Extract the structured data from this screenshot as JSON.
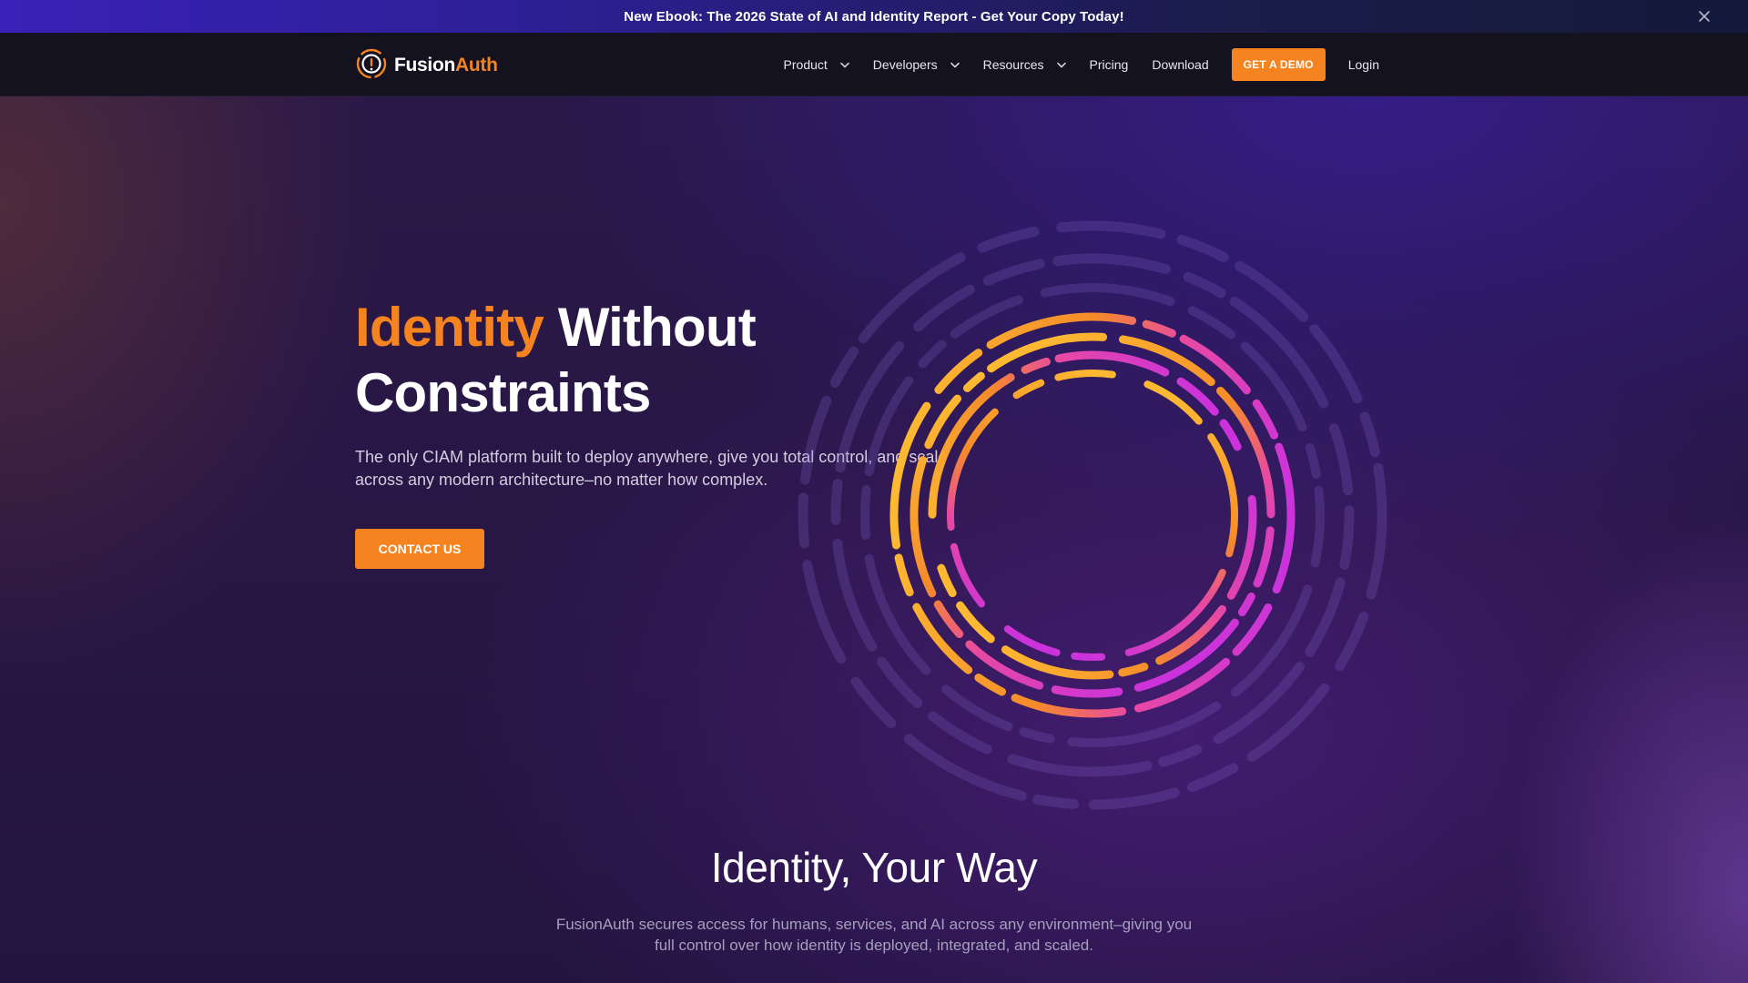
{
  "banner": {
    "text": "New Ebook: The 2026 State of AI and Identity Report - Get Your Copy Today!",
    "close_icon": "close-icon"
  },
  "nav": {
    "logo": {
      "text_part1": "Fusion",
      "text_part2": "Auth",
      "icon": "fusionauth-logo-icon"
    },
    "items": [
      {
        "label": "Product",
        "has_dropdown": true
      },
      {
        "label": "Developers",
        "has_dropdown": true
      },
      {
        "label": "Resources",
        "has_dropdown": true
      },
      {
        "label": "Pricing",
        "has_dropdown": false
      },
      {
        "label": "Download",
        "has_dropdown": false
      }
    ],
    "demo_button": "GET A DEMO",
    "login": "Login"
  },
  "hero": {
    "title_accent": "Identity",
    "title_rest_line1": "Without",
    "title_line2": "Constraints",
    "subtitle": "The only CIAM platform built to deploy anywhere, give you total control, and scale across any modern architecture–no matter how complex.",
    "cta": "CONTACT US"
  },
  "section": {
    "title": "Identity, Your Way",
    "subtitle": "FusionAuth secures access for humans, services, and AI across any environment–giving you full control over how identity is deployed, integrated, and scaled."
  },
  "colors": {
    "brand_orange": "#f58320",
    "ring_yellow": "#ffc233",
    "ring_magenta": "#d42fe0",
    "nav_bg": "#14121e"
  }
}
